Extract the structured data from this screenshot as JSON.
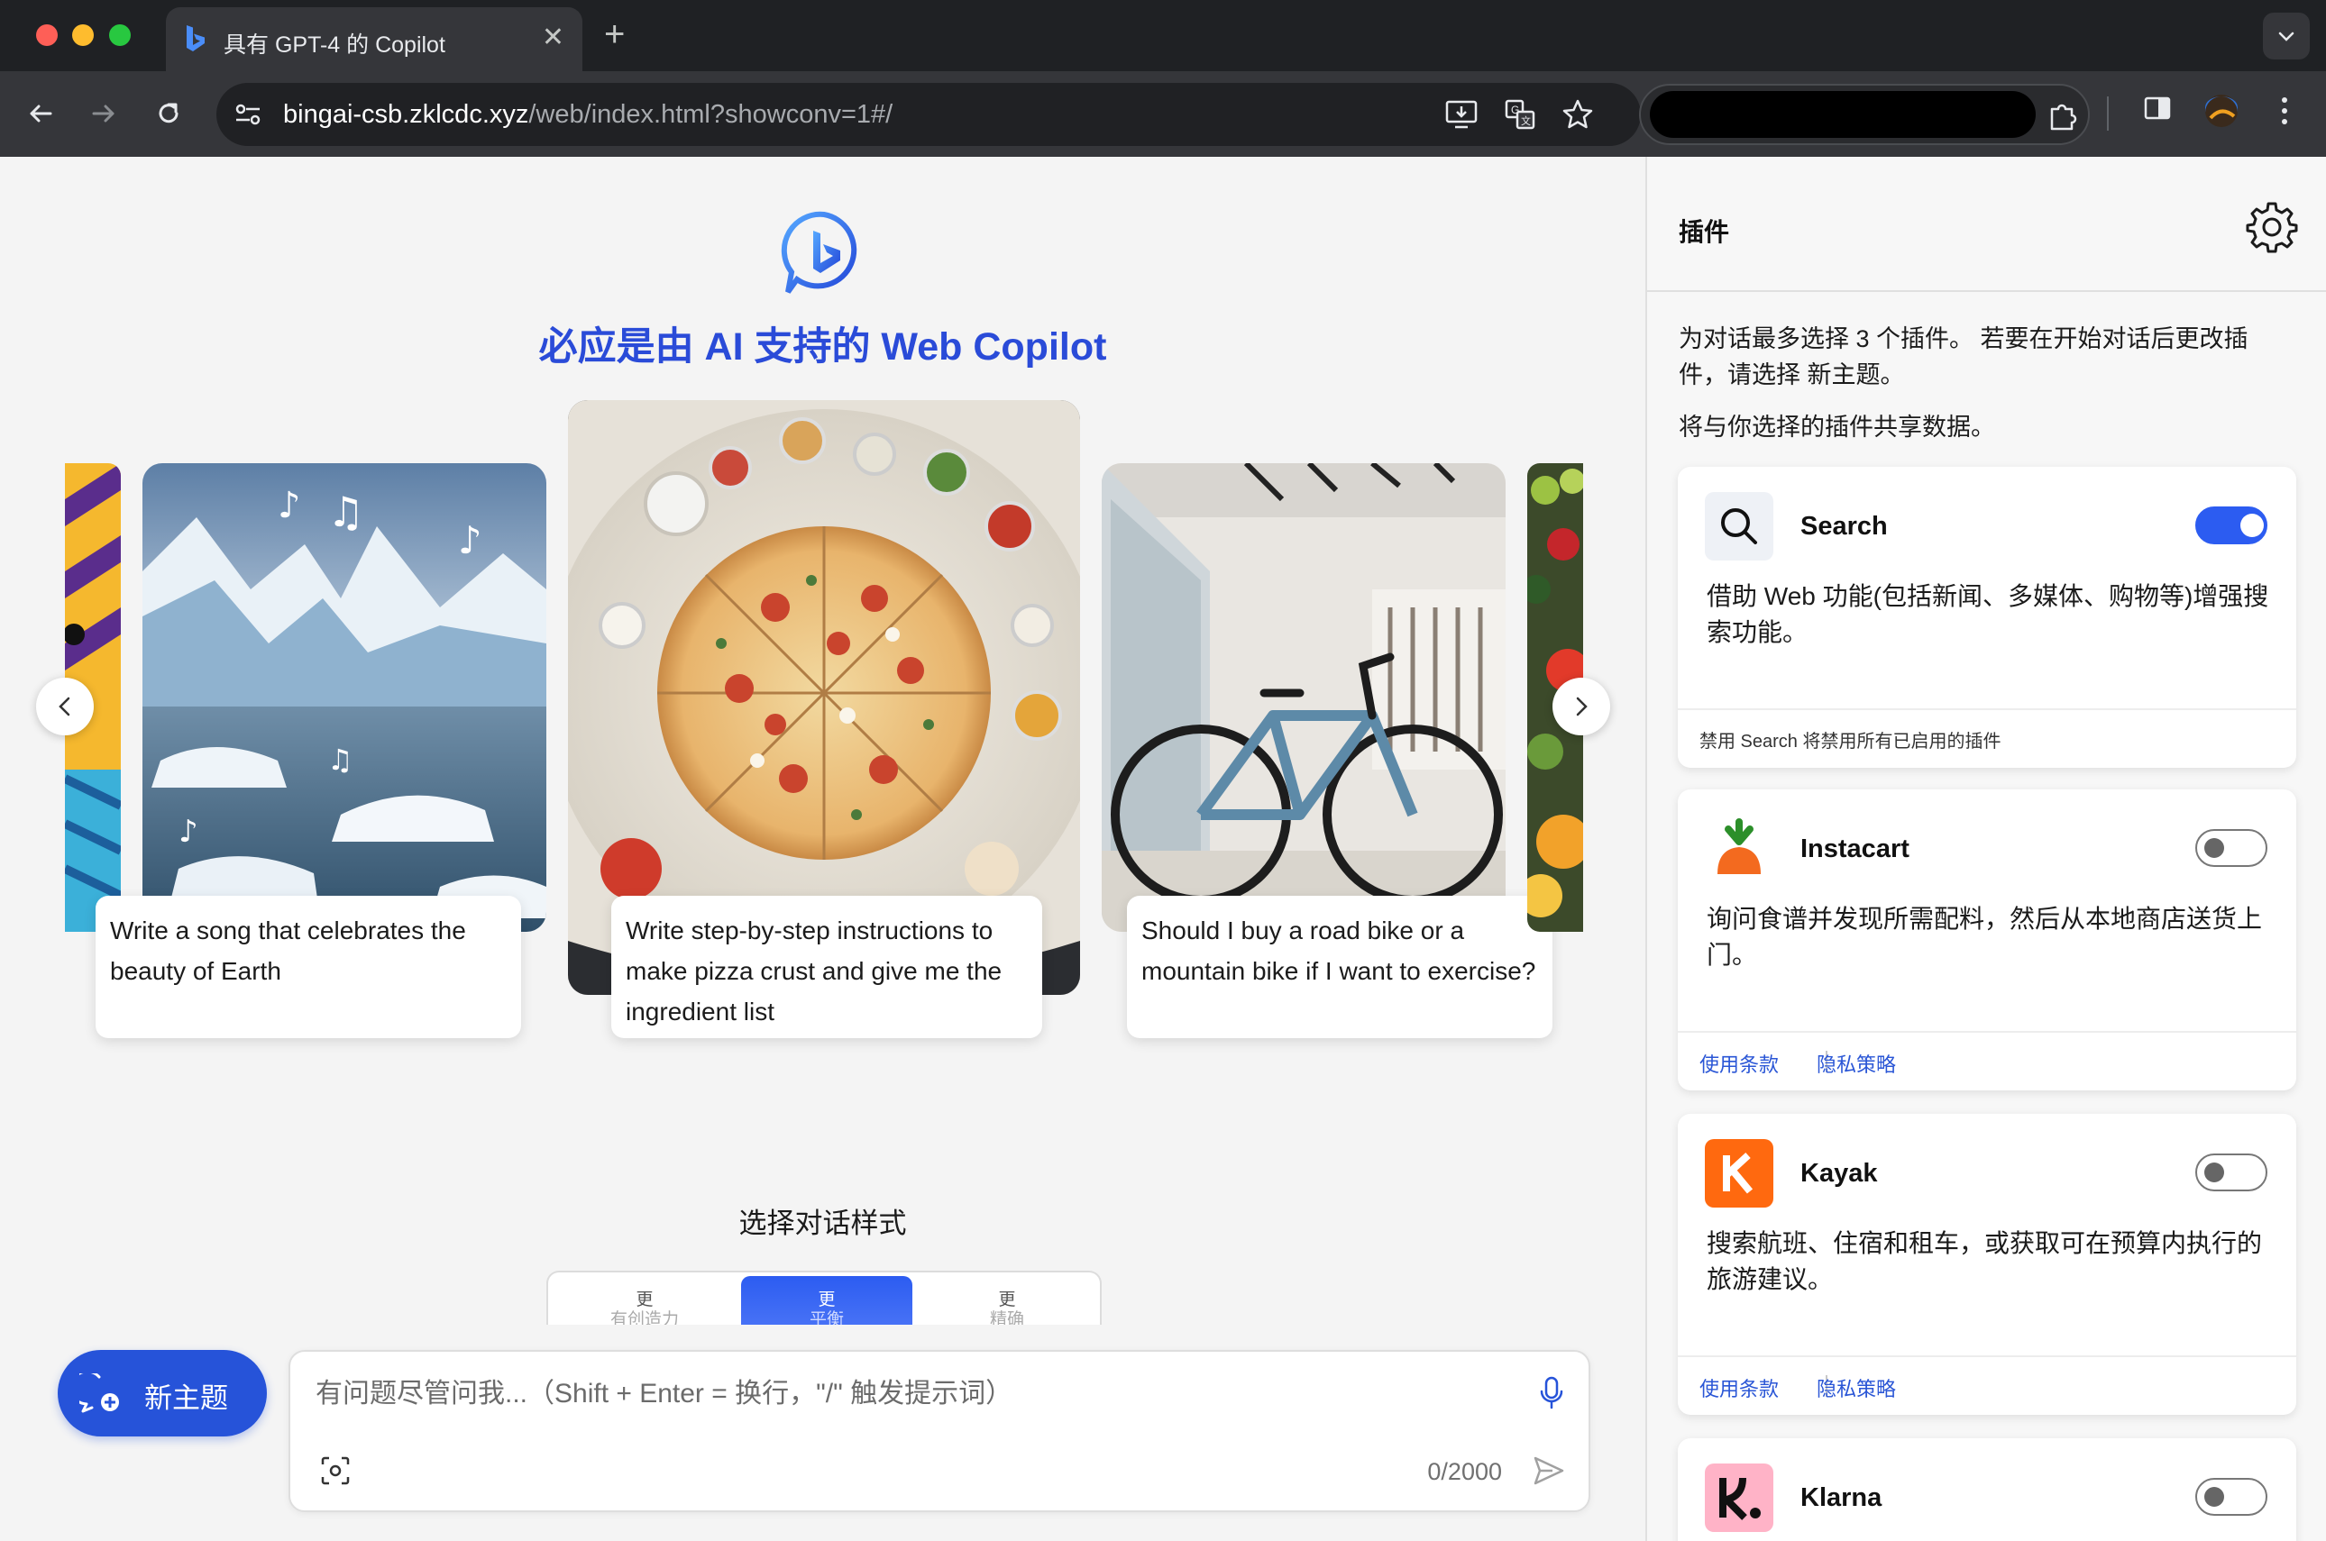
{
  "browser": {
    "tab_title": "具有 GPT-4 的 Copilot",
    "tab_close": "✕",
    "new_tab": "+",
    "url_host": "bingai-csb.zklcdc.xyz",
    "url_path": "/web/index.html?showconv=1#/"
  },
  "page": {
    "headline": "必应是由 AI 支持的 Web Copilot",
    "cards": [
      {
        "caption": "Write a song that celebrates the beauty of Earth",
        "image": "glacier-music-notes"
      },
      {
        "caption": "Write step-by-step instructions to make pizza crust and give me the ingredient list",
        "image": "pizza-ingredients"
      },
      {
        "caption": "Should I buy a road bike or a mountain bike if I want to exercise?",
        "image": "road-bike-showroom"
      }
    ],
    "style_label": "选择对话样式",
    "styles": [
      {
        "top": "更",
        "bottom": "有创造力",
        "active": false
      },
      {
        "top": "更",
        "bottom": "平衡",
        "active": true
      },
      {
        "top": "更",
        "bottom": "精确",
        "active": false
      }
    ],
    "new_topic_label": "新主题",
    "input_placeholder": "有问题尽管问我...（Shift + Enter = 换行，\"/\" 触发提示词）",
    "char_counter": "0/2000"
  },
  "panel": {
    "title": "插件",
    "description": "为对话最多选择 3 个插件。 若要在开始对话后更改插件，请选择 新主题。",
    "share_note": "将与你选择的插件共享数据。",
    "plugins": [
      {
        "name": "Search",
        "enabled": true,
        "description": "借助 Web 功能(包括新闻、多媒体、购物等)增强搜索功能。",
        "footer_note": "禁用 Search 将禁用所有已启用的插件"
      },
      {
        "name": "Instacart",
        "enabled": false,
        "description": "询问食谱并发现所需配料，然后从本地商店送货上门。",
        "terms": "使用条款",
        "privacy": "隐私策略"
      },
      {
        "name": "Kayak",
        "enabled": false,
        "description": "搜索航班、住宿和租车，或获取可在预算内执行的旅游建议。",
        "terms": "使用条款",
        "privacy": "隐私策略"
      },
      {
        "name": "Klarna",
        "enabled": false
      }
    ]
  },
  "colors": {
    "accent": "#2c5cf1",
    "headline": "#2a4bd8",
    "link": "#2a56d6"
  }
}
